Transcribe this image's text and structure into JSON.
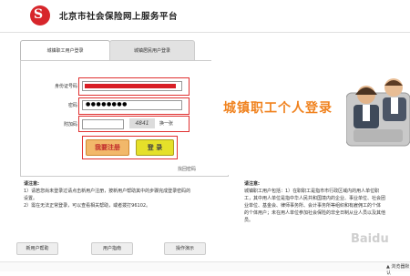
{
  "header": {
    "logo_text": "S",
    "title": "北京市社会保险网上服务平台"
  },
  "tabs": [
    {
      "label": "城镇职工用户登录"
    },
    {
      "label": "城镇居民用户登录"
    }
  ],
  "form": {
    "id_label": "身份证号码",
    "password_label": "密码",
    "password_value": "●●●●●●●●",
    "captcha_label": "附加码",
    "captcha_image_text": "4841",
    "refresh_label": "换一张",
    "register_button": "我要注册",
    "login_button": "登 录",
    "forgot_password": "找回密码"
  },
  "banner": {
    "text": "城镇职工个人登录"
  },
  "notes_left": {
    "title": "请注意:",
    "line1": "1）请若您尚未登录过请点击新用户注册，按新用户帮助其中的步骤完成登录密码的",
    "line2": "设置。",
    "line3": "2）需在无法正常登录，可以查看相关帮助，或者拨打96102。"
  },
  "notes_right": {
    "title": "请注意:",
    "line1": "城镇职工用户包括：1）在职职工是指市市行政区域内的用人单位职",
    "line2": "工，其中用人单位是指中华人民共和国境内的企业、事业单位、社会团",
    "line3": "业单位、基金会、律师事务所、会计事务所等组织和有雇佣工的个体",
    "line4": "的个体用户；未在用人单位参加社会保险的非全日制从业人员以及其他",
    "line5": "员。"
  },
  "bottom_buttons": [
    {
      "label": "新用户帮助"
    },
    {
      "label": "用户指南"
    },
    {
      "label": "操作演示"
    }
  ],
  "browser": {
    "status_text": "▲ 浏览器默认"
  },
  "watermark": "Baidu"
}
